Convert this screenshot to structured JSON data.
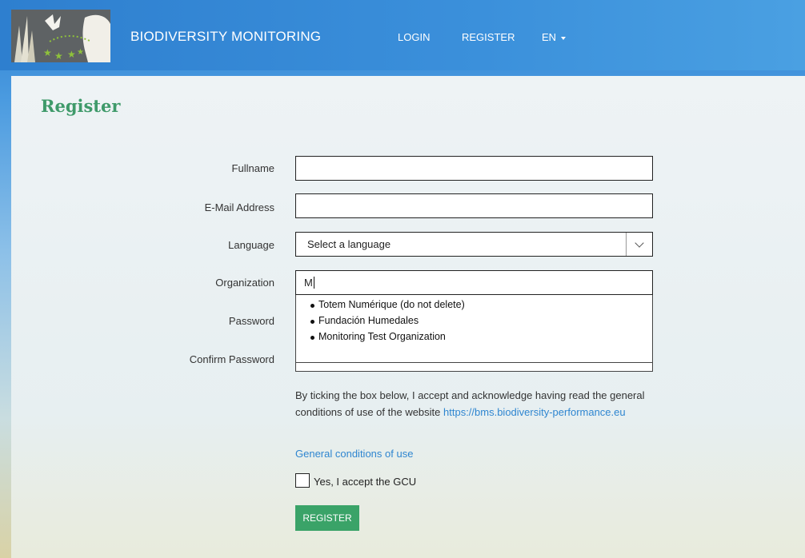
{
  "nav": {
    "brand": "BIODIVERSITY MONITORING",
    "login": "LOGIN",
    "register": "REGISTER",
    "language": "EN"
  },
  "page": {
    "title": "Register"
  },
  "form": {
    "fullname_label": "Fullname",
    "fullname_value": "",
    "email_label": "E-Mail Address",
    "email_value": "",
    "language_label": "Language",
    "language_selected": "Select a language",
    "organization_label": "Organization",
    "organization_value": "M",
    "organization_suggestions": [
      "Totem Numérique (do not delete)",
      "Fundación Humedales",
      "Monitoring Test Organization"
    ],
    "password_label": "Password",
    "confirm_password_label": "Confirm Password",
    "terms_text": "By ticking the box below, I accept and acknowledge having read the general conditions of use of the website",
    "terms_url": "https://bms.biodiversity-performance.eu",
    "gcu_link": "General conditions of use",
    "accept_label": "Yes, I accept the GCU",
    "accept_checked": false,
    "submit_label": "REGISTER"
  },
  "colors": {
    "nav_blue": "#2e7fcf",
    "title_green": "#3f9a6a",
    "button_green": "#3aa368",
    "link_blue": "#2f86d0"
  },
  "icons": [
    "logo-image",
    "caret-down-icon",
    "chevron-down-icon"
  ]
}
